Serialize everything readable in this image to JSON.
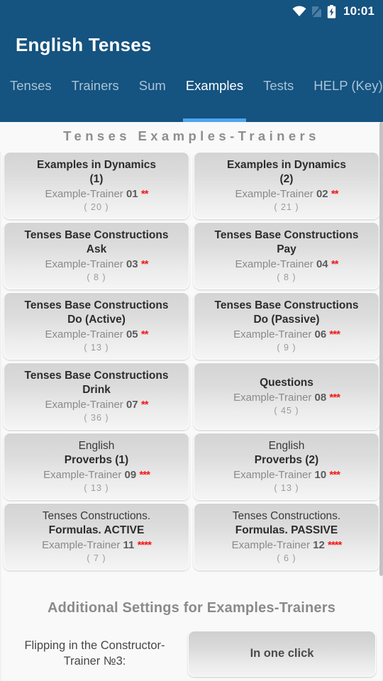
{
  "status_bar": {
    "time": "10:01",
    "icons": [
      "wifi-icon",
      "no-sim-icon",
      "battery-charging-icon"
    ]
  },
  "app_bar": {
    "title": "English Tenses"
  },
  "tabs": {
    "active": "Examples",
    "items": [
      {
        "label": "Tenses"
      },
      {
        "label": "Trainers"
      },
      {
        "label": "Sum"
      },
      {
        "label": "Examples"
      },
      {
        "label": "Tests"
      },
      {
        "label": "HELP (Key)"
      }
    ]
  },
  "content": {
    "section_heading": "Tenses Examples-Trainers",
    "cards": [
      {
        "title_line1": "Examples in Dynamics",
        "title_line1_weight": "bold",
        "title_line2": "(1)",
        "title_line2_weight": "bold",
        "trainer_prefix": "Example-Trainer ",
        "trainer_number": "01",
        "stars": "**",
        "count": "( 20 )"
      },
      {
        "title_line1": "Examples in Dynamics",
        "title_line1_weight": "bold",
        "title_line2": "(2)",
        "title_line2_weight": "bold",
        "trainer_prefix": "Example-Trainer ",
        "trainer_number": "02",
        "stars": "**",
        "count": "( 21 )"
      },
      {
        "title_line1": "Tenses Base Constructions",
        "title_line1_weight": "bold",
        "title_line2": "Ask",
        "title_line2_weight": "bold",
        "trainer_prefix": "Example-Trainer ",
        "trainer_number": "03",
        "stars": "**",
        "count": "( 8 )"
      },
      {
        "title_line1": "Tenses Base Constructions",
        "title_line1_weight": "bold",
        "title_line2": "Pay",
        "title_line2_weight": "bold",
        "trainer_prefix": "Example-Trainer ",
        "trainer_number": "04",
        "stars": "**",
        "count": "( 8 )"
      },
      {
        "title_line1": "Tenses Base Constructions",
        "title_line1_weight": "bold",
        "title_line2": "Do (Active)",
        "title_line2_weight": "bold",
        "trainer_prefix": "Example-Trainer ",
        "trainer_number": "05",
        "stars": "**",
        "count": "( 13 )"
      },
      {
        "title_line1": "Tenses Base Constructions",
        "title_line1_weight": "bold",
        "title_line2": "Do (Passive)",
        "title_line2_weight": "bold",
        "trainer_prefix": "Example-Trainer ",
        "trainer_number": "06",
        "stars": "***",
        "count": "( 9 )"
      },
      {
        "title_line1": "Tenses Base Constructions",
        "title_line1_weight": "bold",
        "title_line2": "Drink",
        "title_line2_weight": "bold",
        "trainer_prefix": "Example-Trainer ",
        "trainer_number": "07",
        "stars": "**",
        "count": "( 36 )"
      },
      {
        "title_line1": "",
        "title_line1_weight": "bold",
        "title_line2": "Questions",
        "title_line2_weight": "bold",
        "trainer_prefix": "Example-Trainer ",
        "trainer_number": "08",
        "stars": "***",
        "count": "( 45 )"
      },
      {
        "title_line1": "English",
        "title_line1_weight": "normal",
        "title_line2": "Proverbs (1)",
        "title_line2_weight": "bold",
        "trainer_prefix": "Example-Trainer ",
        "trainer_number": "09",
        "stars": "***",
        "count": "( 13 )"
      },
      {
        "title_line1": "English",
        "title_line1_weight": "normal",
        "title_line2": "Proverbs (2)",
        "title_line2_weight": "bold",
        "trainer_prefix": "Example-Trainer ",
        "trainer_number": "10",
        "stars": "***",
        "count": "( 13 )"
      },
      {
        "title_line1": "Tenses Constructions.",
        "title_line1_weight": "normal",
        "title_line2": "Formulas. ACTIVE",
        "title_line2_weight": "bold",
        "trainer_prefix": "Example-Trainer ",
        "trainer_number": "11",
        "stars": "****",
        "count": "( 7 )"
      },
      {
        "title_line1": "Tenses Constructions.",
        "title_line1_weight": "normal",
        "title_line2": "Formulas. PASSIVE",
        "title_line2_weight": "bold",
        "trainer_prefix": "Example-Trainer ",
        "trainer_number": "12",
        "stars": "****",
        "count": "( 6 )"
      }
    ],
    "settings": {
      "heading": "Additional  Settings  for Examples-Trainers",
      "row_label": "Flipping in the Constructor-Trainer №3:",
      "button_label": "In one click"
    }
  },
  "colors": {
    "header_blue": "#155380",
    "tab_indicator": "#4ea6ef",
    "tab_inactive": "#a9c3d6",
    "star_red": "#f31a1a",
    "page_bg": "#f9f9f9"
  }
}
